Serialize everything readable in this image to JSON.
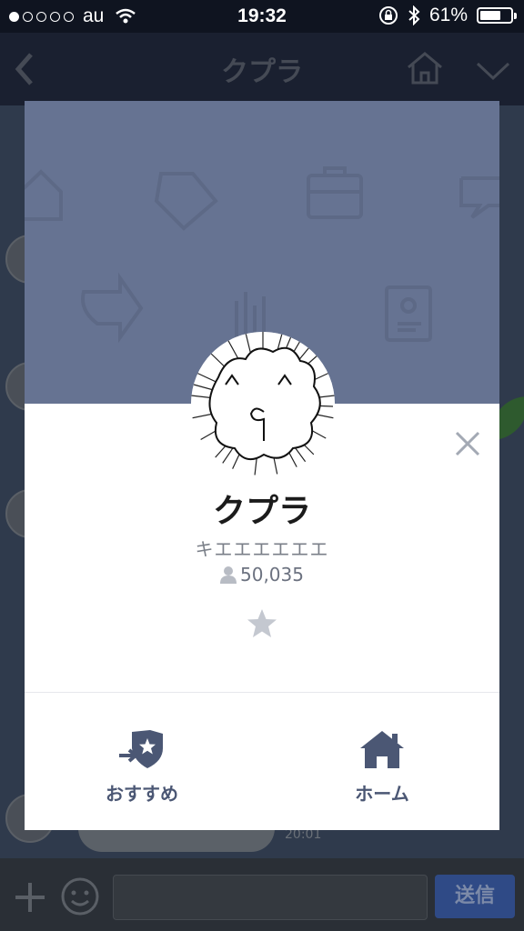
{
  "status_bar": {
    "carrier": "au",
    "time": "19:32",
    "battery": "61%"
  },
  "nav": {
    "title": "クプラ"
  },
  "chat_background": {
    "last_message_time": "20:01"
  },
  "input_bar": {
    "send_label": "送信"
  },
  "profile": {
    "name": "クプラ",
    "status_message": "キエエエエエエ",
    "friend_count": "50,035"
  },
  "actions": [
    {
      "label": "おすすめ",
      "icon": "recommend-shield-star-icon"
    },
    {
      "label": "ホーム",
      "icon": "home-icon"
    }
  ],
  "colors": {
    "cover": "#667392",
    "accent": "#4b5774",
    "send_button": "#2f4a86"
  }
}
